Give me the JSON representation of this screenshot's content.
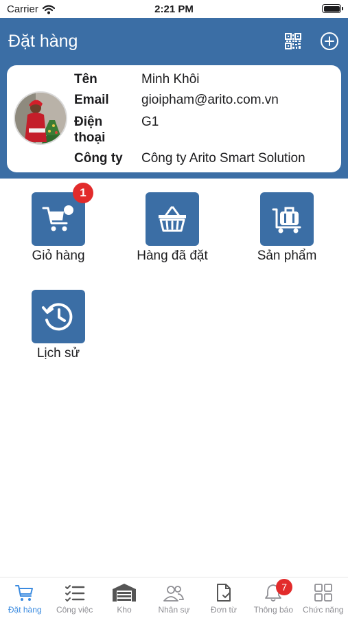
{
  "status_bar": {
    "carrier": "Carrier",
    "time": "2:21 PM"
  },
  "header": {
    "title": "Đặt hàng",
    "qr_icon": "qr-code-icon",
    "add_icon": "plus-circle-icon"
  },
  "profile": {
    "name_label": "Tên",
    "name_value": "Minh Khôi",
    "email_label": "Email",
    "email_value": "gioipham@arito.com.vn",
    "phone_label_line1": "Điện",
    "phone_label_line2": "thoại",
    "phone_value": "G1",
    "company_label": "Công ty",
    "company_value": "Công ty Arito Smart Solution"
  },
  "menu": {
    "items": [
      {
        "label": "Giỏ hàng",
        "icon": "cart-icon",
        "badge": "1"
      },
      {
        "label": "Hàng đã đặt",
        "icon": "basket-icon"
      },
      {
        "label": "Sản phẩm",
        "icon": "luggage-cart-icon"
      },
      {
        "label": "Lịch sử",
        "icon": "history-icon"
      }
    ]
  },
  "tabs": [
    {
      "label": "Đặt hàng",
      "icon": "cart-icon",
      "active": true
    },
    {
      "label": "Công việc",
      "icon": "checklist-icon"
    },
    {
      "label": "Kho",
      "icon": "warehouse-icon"
    },
    {
      "label": "Nhân sự",
      "icon": "people-icon"
    },
    {
      "label": "Đơn từ",
      "icon": "document-check-icon"
    },
    {
      "label": "Thông báo",
      "icon": "bell-icon",
      "badge": "7"
    },
    {
      "label": "Chức năng",
      "icon": "grid-icon"
    }
  ],
  "colors": {
    "brand": "#3b6ea5",
    "active_tab": "#3b8be0",
    "badge": "#e22b2b"
  }
}
